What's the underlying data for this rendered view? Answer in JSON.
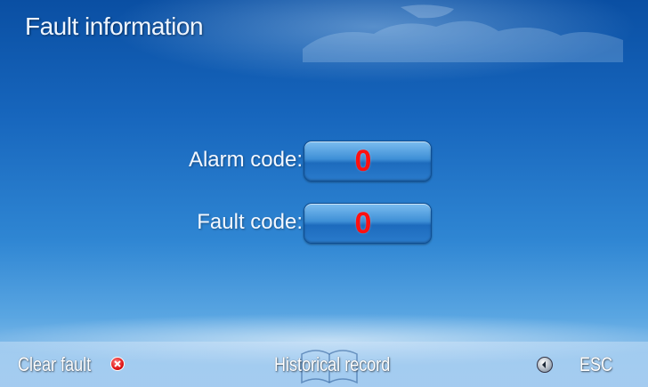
{
  "header": {
    "title": "Fault information"
  },
  "fields": {
    "alarm": {
      "label": "Alarm code:",
      "value": "0"
    },
    "fault": {
      "label": "Fault code:",
      "value": "0"
    }
  },
  "footer": {
    "clear_fault": "Clear fault",
    "historical_record": "Historical record",
    "esc": "ESC"
  },
  "colors": {
    "value_text": "#ff1010",
    "background_top": "#0a4fa3",
    "background_bottom": "#a8cff0"
  },
  "icons": {
    "clear": "clear-x-icon",
    "history": "book-icon",
    "back": "back-arrow-icon"
  }
}
